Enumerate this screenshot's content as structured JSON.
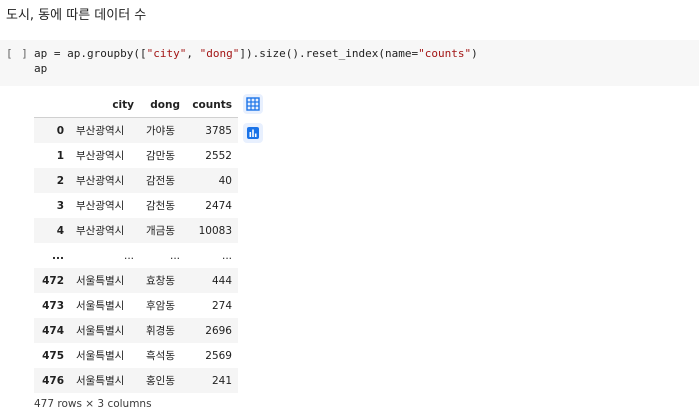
{
  "heading": "도시, 동에 따른 데이터 수",
  "cell": {
    "run_bracket": "[ ]",
    "line1_a": "ap = ap.groupby([",
    "line1_s1": "\"city\"",
    "line1_b": ", ",
    "line1_s2": "\"dong\"",
    "line1_c": "]).size().reset_index(name=",
    "line1_s3": "\"counts\"",
    "line1_d": ")",
    "line2": "ap"
  },
  "table": {
    "columns": [
      "city",
      "dong",
      "counts"
    ],
    "rows": [
      {
        "idx": "0",
        "city": "부산광역시",
        "dong": "가야동",
        "counts": "3785"
      },
      {
        "idx": "1",
        "city": "부산광역시",
        "dong": "감만동",
        "counts": "2552"
      },
      {
        "idx": "2",
        "city": "부산광역시",
        "dong": "감전동",
        "counts": "40"
      },
      {
        "idx": "3",
        "city": "부산광역시",
        "dong": "감천동",
        "counts": "2474"
      },
      {
        "idx": "4",
        "city": "부산광역시",
        "dong": "개금동",
        "counts": "10083"
      },
      {
        "idx": "...",
        "city": "...",
        "dong": "...",
        "counts": "..."
      },
      {
        "idx": "472",
        "city": "서울특별시",
        "dong": "효창동",
        "counts": "444"
      },
      {
        "idx": "473",
        "city": "서울특별시",
        "dong": "후암동",
        "counts": "274"
      },
      {
        "idx": "474",
        "city": "서울특별시",
        "dong": "휘경동",
        "counts": "2696"
      },
      {
        "idx": "475",
        "city": "서울특별시",
        "dong": "흑석동",
        "counts": "2569"
      },
      {
        "idx": "476",
        "city": "서울특별시",
        "dong": "홍인동",
        "counts": "241"
      }
    ]
  },
  "shape_note": "477 rows × 3 columns",
  "icons": {
    "table_view": "table-grid-icon",
    "chart_suggest": "bar-chart-icon"
  },
  "colors": {
    "accent": "#1a73e8",
    "icon_bg": "#e8f0fe",
    "string": "#a31515"
  }
}
